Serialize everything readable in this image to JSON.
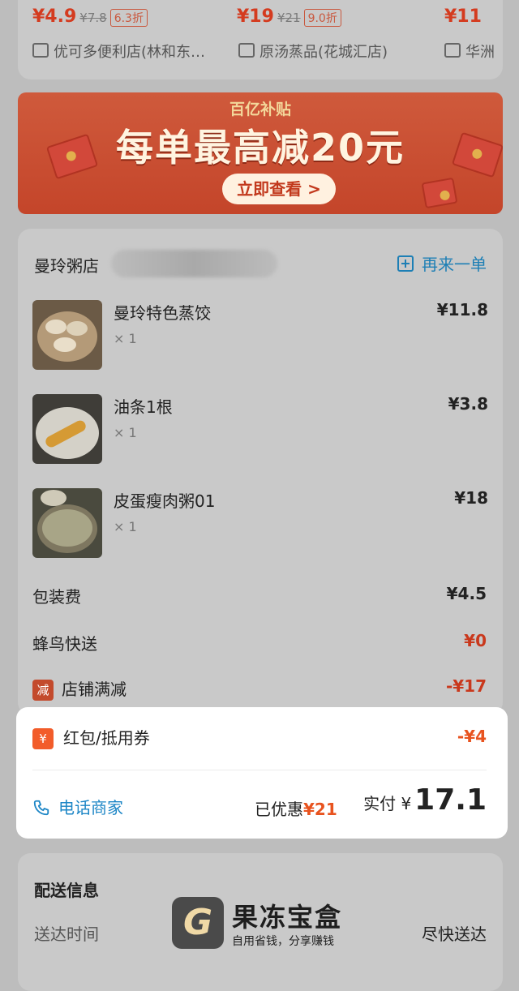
{
  "top_recommendations": [
    {
      "price": "¥4.9",
      "original": "¥7.8",
      "discount": "6.3折",
      "store": "优可多便利店(林和东…"
    },
    {
      "price": "¥19",
      "original": "¥21",
      "discount": "9.0折",
      "store": "原汤蒸品(花城汇店)"
    },
    {
      "price": "¥11",
      "original": "",
      "discount": "",
      "store": "华洲"
    }
  ],
  "banner": {
    "subtitle": "百亿补贴",
    "headline": "每单最高减20元",
    "cta": "立即查看 >"
  },
  "order": {
    "shop_name": "曼玲粥店",
    "reorder_label": "再来一单",
    "items": [
      {
        "name": "曼玲特色蒸饺",
        "qty": "× 1",
        "price": "¥11.8",
        "image_icon": "dumpling-photo"
      },
      {
        "name": "油条1根",
        "qty": "× 1",
        "price": "¥3.8",
        "image_icon": "youtiao-photo"
      },
      {
        "name": "皮蛋瘦肉粥01",
        "qty": "× 1",
        "price": "¥18",
        "image_icon": "congee-photo"
      }
    ],
    "fees": {
      "packing_label": "包装费",
      "packing_value": "¥4.5",
      "delivery_label": "蜂鸟快送",
      "delivery_value": "¥0",
      "discount_badge": "减",
      "discount_label": "店铺满减",
      "discount_value": "-¥17"
    }
  },
  "summary": {
    "redpacket_badge": "¥",
    "redpacket_label": "红包/抵用券",
    "redpacket_value": "-¥4",
    "call_label": "电话商家",
    "saved_label": "已优惠",
    "saved_value": "¥21",
    "pay_label": "实付",
    "pay_currency": "¥",
    "pay_value": "17.1"
  },
  "delivery": {
    "title": "配送信息",
    "time_label": "送达时间",
    "time_value": "尽快送达"
  },
  "watermark": {
    "logo": "G",
    "name": "果冻宝盒",
    "slogan": "自用省钱，分享赚钱"
  },
  "colors": {
    "accent_blue": "#1d86c6",
    "accent_red": "#e8531f",
    "overlay_gray": "#bdbdbd"
  }
}
